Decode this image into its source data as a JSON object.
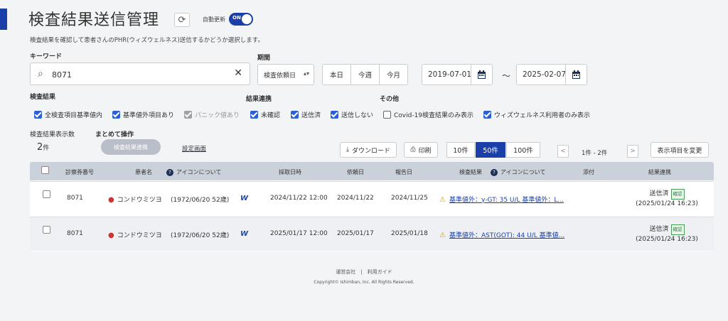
{
  "header": {
    "title": "検査結果送信管理",
    "auto_update_label": "自動更新",
    "toggle_label": "ON",
    "description": "検査結果を確認して患者さんのPHR(ウィズウェルネス)送信するかどうか選択します。"
  },
  "search": {
    "keyword_label": "キーワード",
    "keyword_value": "8071",
    "period_label": "期間",
    "period_select": "検査依頼日",
    "quick_ranges": [
      "本日",
      "今週",
      "今月"
    ],
    "date_from": "2019-07-01",
    "date_to": "2025-02-07",
    "tilde": "～"
  },
  "filters": {
    "result_label": "検査結果",
    "link_label": "結果連携",
    "other_label": "その他",
    "items": [
      {
        "label": "全検査項目基準値内",
        "state": "on"
      },
      {
        "label": "基準値外項目あり",
        "state": "on"
      },
      {
        "label": "パニック値あり",
        "state": "disabled"
      },
      {
        "label": "未確認",
        "state": "on"
      },
      {
        "label": "送信済",
        "state": "on"
      },
      {
        "label": "送信しない",
        "state": "on"
      },
      {
        "label": "Covid-19検査結果のみ表示",
        "state": "off"
      },
      {
        "label": "ウィズウェルネス利用者のみ表示",
        "state": "on"
      }
    ]
  },
  "toolbar": {
    "count_label": "検査結果表示数",
    "count_value": "2",
    "count_unit": "件",
    "bulk_label": "まとめて操作",
    "bulk_button": "検査結果連携",
    "settings_link": "設定画面",
    "download": "ダウンロード",
    "print": "印刷",
    "page_sizes": [
      "10件",
      "50件",
      "100件"
    ],
    "active_page_size": "50件",
    "page_info": "1件 - 2件",
    "prev": "<",
    "next": ">",
    "change_columns": "表示項目を変更"
  },
  "table": {
    "headers": [
      "診察券番号",
      "患者名",
      "アイコンについて",
      "採取日時",
      "依頼日",
      "報告日",
      "検査結果",
      "アイコンについて",
      "添付",
      "結果連携"
    ],
    "rows": [
      {
        "card_no": "8071",
        "patient": "コンドウミツヨ",
        "dob": "(1972/06/20 52歳)",
        "icon": "W",
        "collected": "2024/11/22 12:00",
        "requested": "2024/11/22",
        "reported": "2024/11/25",
        "result": "基準値外：γ-GT: 35 U/L 基準値外：L...",
        "status": "送信済",
        "badge": "確認",
        "status_date": "(2025/01/24 16:23)"
      },
      {
        "card_no": "8071",
        "patient": "コンドウミツヨ",
        "dob": "(1972/06/20 52歳)",
        "icon": "W",
        "collected": "2025/01/17 12:00",
        "requested": "2025/01/17",
        "reported": "2025/01/18",
        "result": "基準値外：AST(GOT): 44 U/L 基準値...",
        "status": "送信済",
        "badge": "確認",
        "status_date": "(2025/01/24 16:23)"
      }
    ]
  },
  "footer": {
    "links": "運営会社　|　利用ガイド",
    "copyright": "Copyright© Ishimban, Inc. All Rights Reserved."
  },
  "colors": {
    "accent": "#1a3fa8",
    "checkbox": "#2b5fd9",
    "header_bg": "#cbd1da"
  }
}
